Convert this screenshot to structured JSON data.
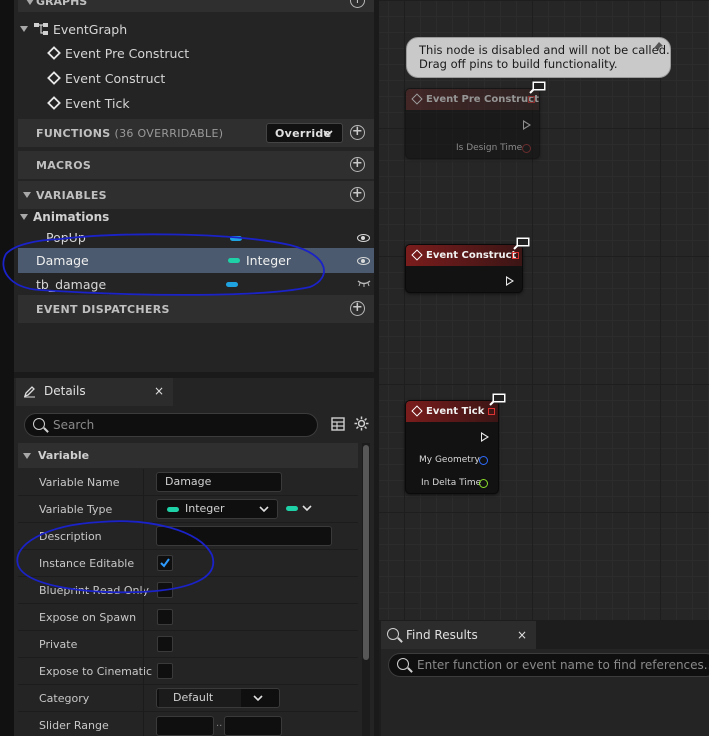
{
  "my_blueprint": {
    "graphs_header": "GRAPHS",
    "event_graph": "EventGraph",
    "events": [
      "Event Pre Construct",
      "Event Construct",
      "Event Tick"
    ],
    "functions": {
      "label": "FUNCTIONS",
      "count": "(36 OVERRIDABLE)",
      "override_label": "Override"
    },
    "macros_label": "MACROS",
    "variables_label": "VARIABLES",
    "category": "Animations",
    "variables": [
      {
        "name": "PopUp",
        "type": "",
        "color": "#1fa3e0",
        "selected": false
      },
      {
        "name": "Damage",
        "type": "Integer",
        "color": "#1fd1a7",
        "selected": true
      },
      {
        "name": "tb_damage",
        "type": "",
        "color": "#1fa3e0",
        "selected": false
      }
    ],
    "dispatchers_label": "EVENT DISPATCHERS"
  },
  "details": {
    "tab_label": "Details",
    "close": "×",
    "search_placeholder": "Search",
    "section_label": "Variable",
    "rows": {
      "variable_name": {
        "label": "Variable Name",
        "value": "Damage"
      },
      "variable_type": {
        "label": "Variable Type",
        "value": "Integer"
      },
      "description": {
        "label": "Description",
        "value": ""
      },
      "instance_editable": {
        "label": "Instance Editable",
        "checked": true
      },
      "blueprint_read_only": {
        "label": "Blueprint Read Only",
        "checked": false
      },
      "expose_on_spawn": {
        "label": "Expose on Spawn",
        "checked": false
      },
      "private": {
        "label": "Private",
        "checked": false
      },
      "expose_cinematics": {
        "label": "Expose to Cinematic",
        "checked": false
      },
      "category": {
        "label": "Category",
        "value": "Default"
      },
      "slider_range": {
        "label": "Slider Range",
        "value": ""
      }
    }
  },
  "graph": {
    "disabled_tooltip": {
      "line1": "This node is disabled and will not be called.",
      "line2": "Drag off pins to build functionality."
    },
    "nodes": {
      "pre_construct": {
        "title": "Event Pre Construct",
        "pin": "Is Design Time"
      },
      "construct": {
        "title": "Event Construct"
      },
      "tick": {
        "title": "Event Tick",
        "pins": [
          "My Geometry",
          "In Delta Time"
        ]
      }
    }
  },
  "find_results": {
    "tab_label": "Find Results",
    "close": "×",
    "search_placeholder": "Enter function or event name to find references..."
  },
  "colors": {
    "annotation": "#1a22c8",
    "integer_pin": "#1fd1a7",
    "object_pin": "#1fa3e0",
    "event_header": "#7a1c1c",
    "checkbox_check": "#2e9bff"
  }
}
